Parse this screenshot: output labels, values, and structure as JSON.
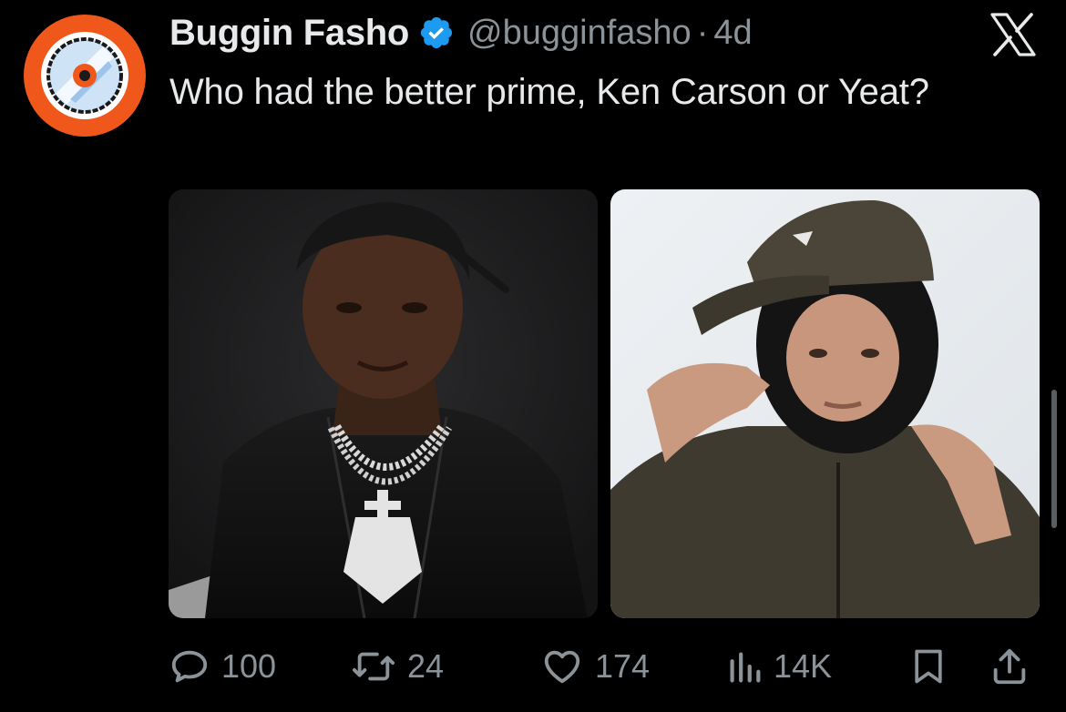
{
  "tweet": {
    "display_name": "Buggin Fasho",
    "handle": "@bugginfasho",
    "separator": "·",
    "age": "4d",
    "text": "Who had the better prime, Ken Carson or Yeat?",
    "avatar_icon": "pixel-disc-logo",
    "verified_icon": "verified-badge-icon",
    "brand_icon": "x-logo-icon",
    "media": [
      {
        "alt_icon": "photo-man-dark-jacket-chains"
      },
      {
        "alt_icon": "photo-man-cap-balaclava"
      }
    ]
  },
  "actions": {
    "reply_count": "100",
    "retweet_count": "24",
    "like_count": "174",
    "view_count": "14K"
  },
  "colors": {
    "background": "#000000",
    "text": "#e7e9ea",
    "muted": "#8b9298",
    "verified": "#1d9bf0",
    "avatar_ring": "#f0581b"
  }
}
